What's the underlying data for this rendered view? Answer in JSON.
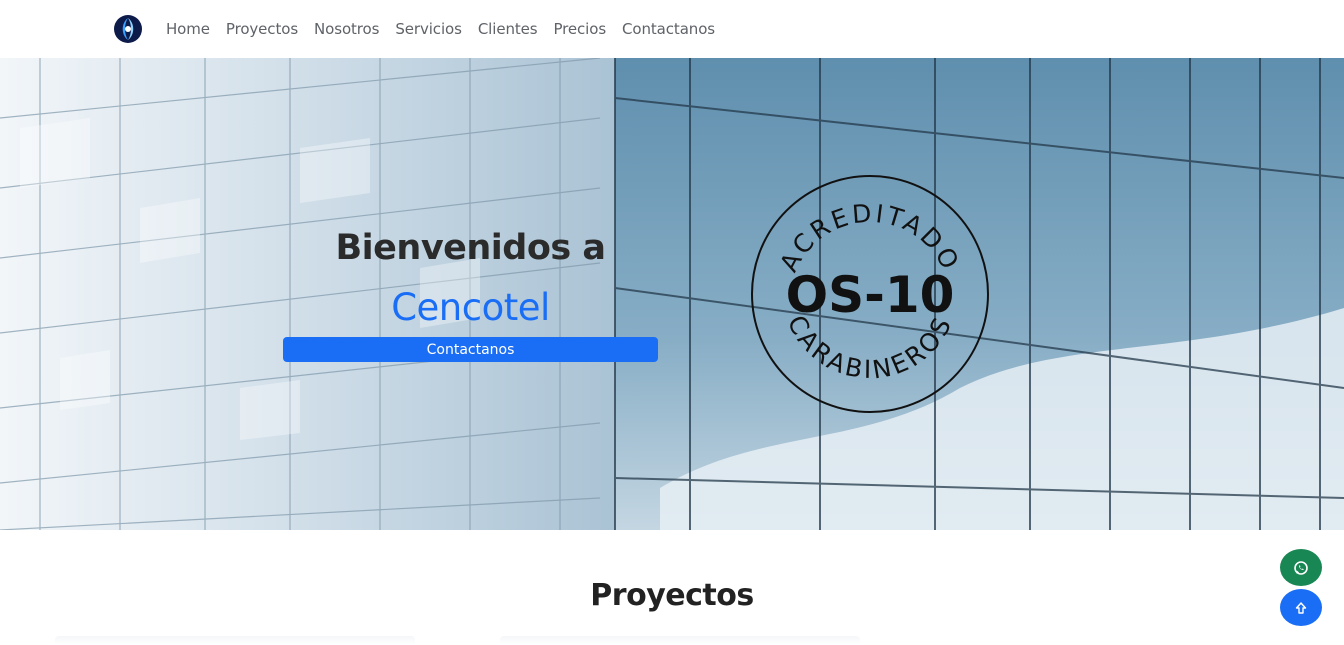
{
  "nav": {
    "logo_icon": "cencotel-logo-icon",
    "items": [
      {
        "label": "Home"
      },
      {
        "label": "Proyectos"
      },
      {
        "label": "Nosotros"
      },
      {
        "label": "Servicios"
      },
      {
        "label": "Clientes"
      },
      {
        "label": "Precios"
      },
      {
        "label": "Contactanos"
      }
    ]
  },
  "hero": {
    "title": "Bienvenidos a",
    "brand": "Cencotel",
    "button_label": "Contactanos",
    "badge": {
      "top_text": "ACREDITADO",
      "center_text": "OS-10",
      "bottom_text": "CARABINEROS"
    }
  },
  "section": {
    "title": "Proyectos"
  },
  "floating": {
    "whatsapp_icon": "whatsapp-icon",
    "scroll_top_icon": "arrow-up-icon"
  },
  "colors": {
    "primary": "#1a6ef5",
    "whatsapp": "#198754"
  }
}
